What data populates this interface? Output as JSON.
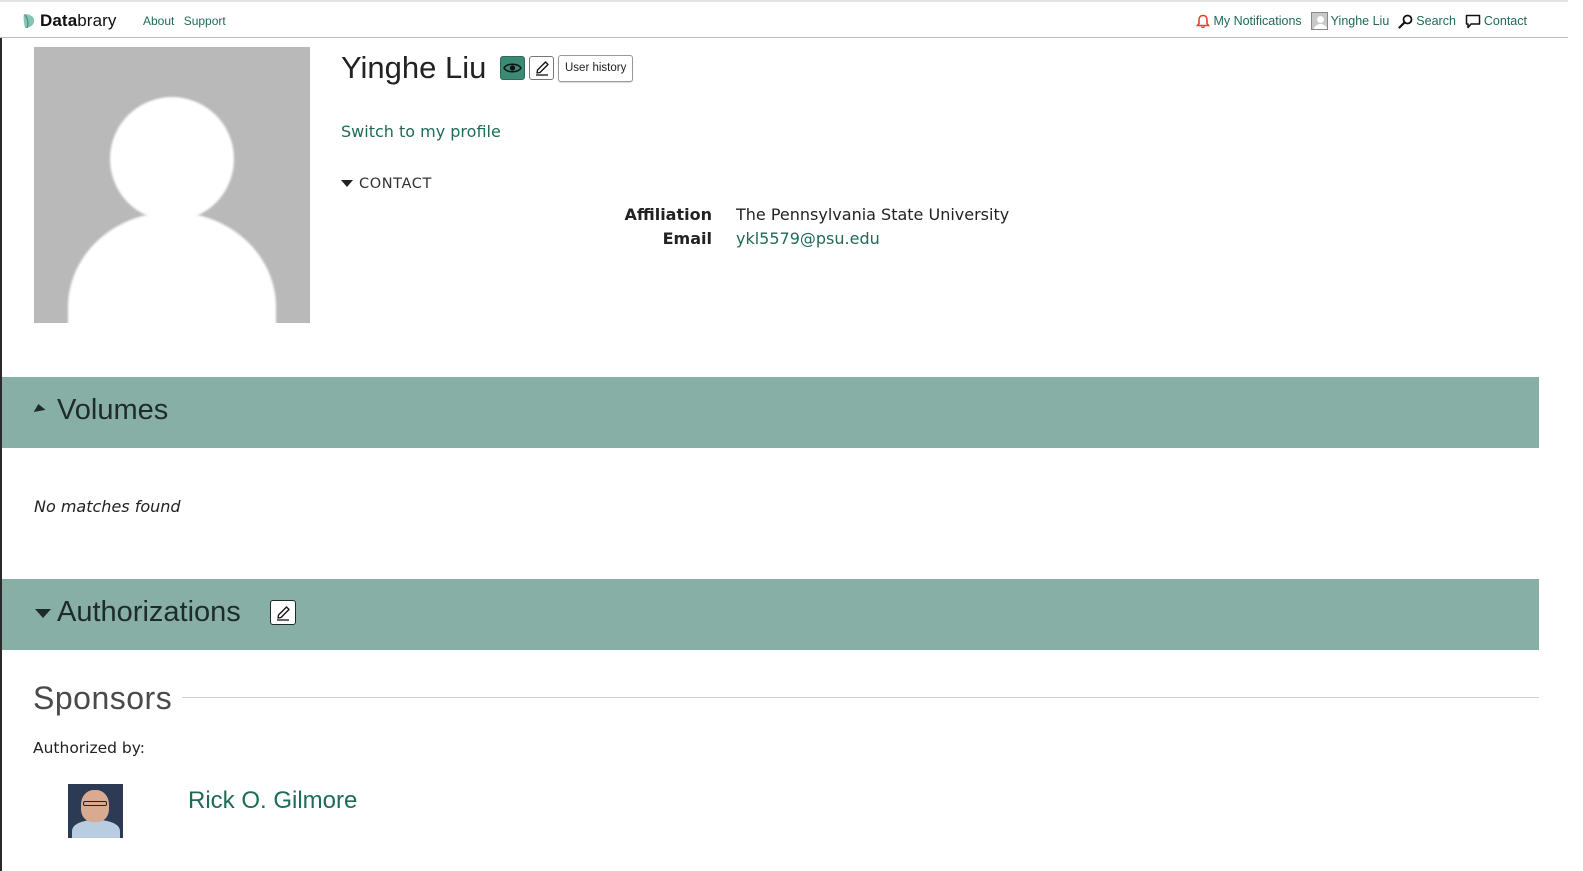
{
  "nav": {
    "brand": {
      "bold": "Data",
      "rest": "brary"
    },
    "links": [
      "About",
      "Support"
    ],
    "notifications_label": "My Notifications",
    "user_label": "Yinghe Liu",
    "search_label": "Search",
    "contact_label": "Contact"
  },
  "profile": {
    "name": "Yinghe Liu",
    "history_label": "User history",
    "switch_link": "Switch to my profile",
    "contact_heading": "CONTACT",
    "affiliation_label": "Affiliation",
    "affiliation_value": "The Pennsylvania State University",
    "email_label": "Email",
    "email_value": "ykl5579@psu.edu"
  },
  "volumes": {
    "title": "Volumes",
    "empty_text": "No matches found"
  },
  "authorizations": {
    "title": "Authorizations",
    "sponsors_title": "Sponsors",
    "authorized_by": "Authorized by:",
    "sponsor_name": "Rick O. Gilmore"
  },
  "colors": {
    "accent": "#1f6b57",
    "section_bar": "#87afa6",
    "notification_icon": "#e0432b",
    "eye_button": "#3d8a74"
  }
}
